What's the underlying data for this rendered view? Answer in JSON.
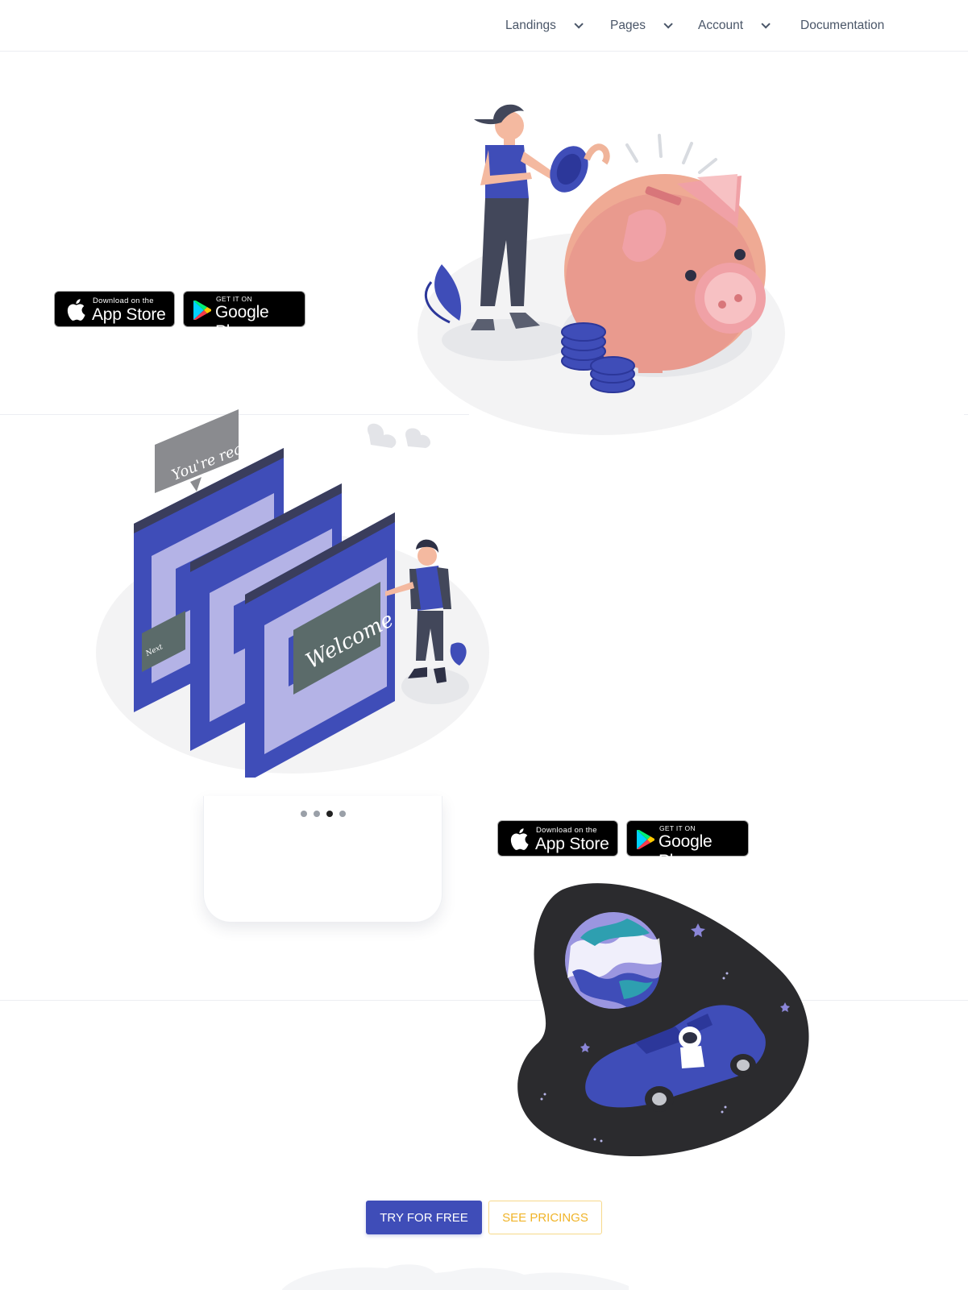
{
  "nav": {
    "items": [
      {
        "label": "Landings",
        "has_dropdown": true
      },
      {
        "label": "Pages",
        "has_dropdown": true
      },
      {
        "label": "Account",
        "has_dropdown": true
      },
      {
        "label": "Documentation",
        "has_dropdown": false
      }
    ]
  },
  "stores": {
    "apple_small": "Download on the",
    "apple_big": "App Store",
    "google_small": "GET IT ON",
    "google_big": "Google Play"
  },
  "illustrations": {
    "welcome_bubble": "You're ready!",
    "welcome_popup": "Welcome",
    "next_popup": "Next"
  },
  "carousel": {
    "count": 4,
    "active_index": 2
  },
  "cta": {
    "primary_label": "TRY FOR FREE",
    "secondary_label": "SEE PRICINGS"
  },
  "colors": {
    "accent": "#3f4db8",
    "secondary": "#f0b429"
  }
}
